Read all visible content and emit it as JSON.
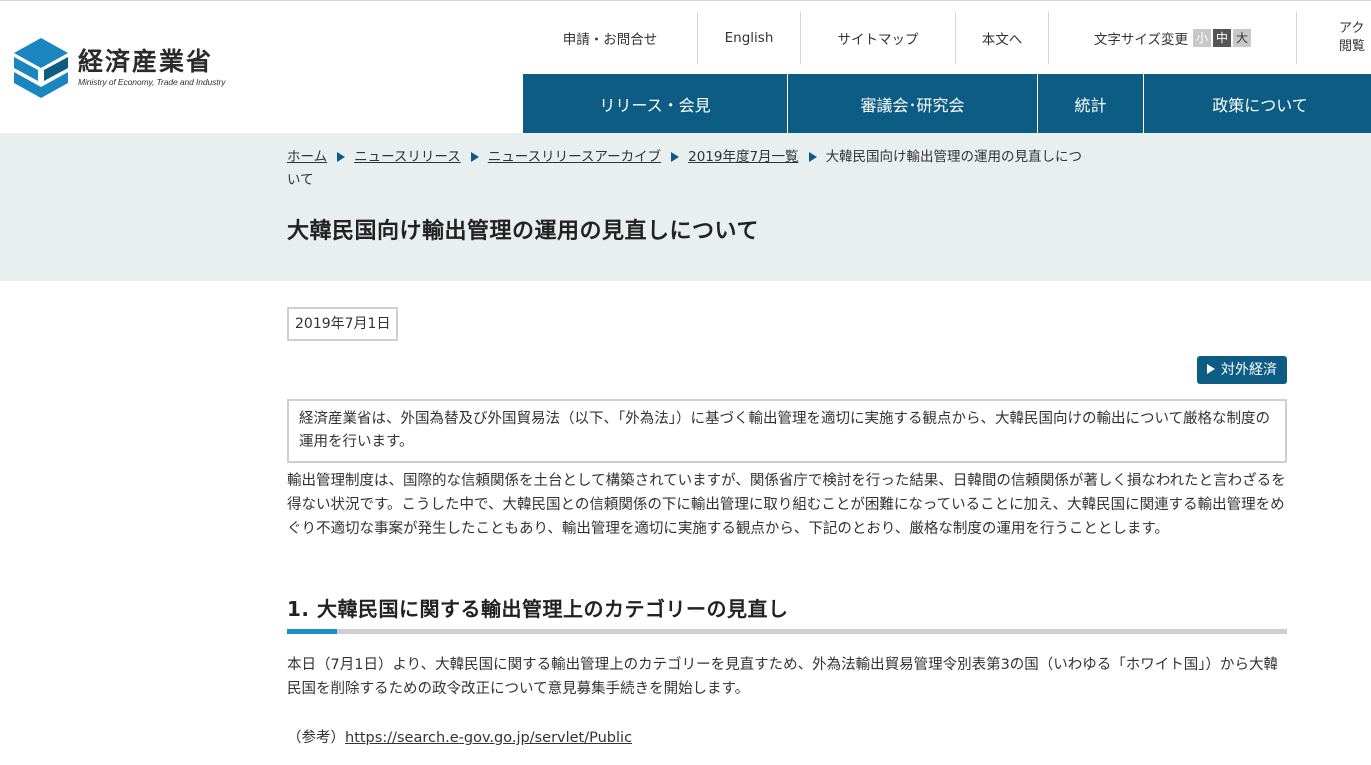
{
  "header": {
    "logo_jp": "経済産業省",
    "logo_en": "Ministry of Economy, Trade and Industry",
    "util_nav": {
      "contact": "申請・お問合せ",
      "english": "English",
      "sitemap": "サイトマップ",
      "skip": "本文へ",
      "font_size_label": "文字サイズ変更",
      "font_small": "小",
      "font_mid": "中",
      "font_large": "大",
      "access_line1": "アク",
      "access_line2": "閲覧"
    },
    "main_nav": [
      "リリース・会見",
      "審議会･研究会",
      "統計",
      "政策について"
    ]
  },
  "breadcrumb": {
    "items": [
      "ホーム",
      "ニュースリリース",
      "ニュースリリースアーカイブ",
      "2019年度7月一覧"
    ],
    "current": "大韓民国向け輸出管理の運用の見直しについて"
  },
  "page_title": "大韓民国向け輸出管理の運用の見直しについて",
  "content": {
    "date": "2019年7月1日",
    "tag": "対外経済",
    "lead": "経済産業省は、外国為替及び外国貿易法（以下、「外為法」）に基づく輸出管理を適切に実施する観点から、大韓民国向けの輸出について厳格な制度の運用を行います。",
    "body": "輸出管理制度は、国際的な信頼関係を土台として構築されていますが、関係省庁で検討を行った結果、日韓間の信頼関係が著しく損なわれたと言わざるを得ない状況です。こうした中で、大韓民国との信頼関係の下に輸出管理に取り組むことが困難になっていることに加え、大韓民国に関連する輸出管理をめぐり不適切な事案が発生したこともあり、輸出管理を適切に実施する観点から、下記のとおり、厳格な制度の運用を行うこととします。",
    "section1_title": "1.  大韓民国に関する輸出管理上のカテゴリーの見直し",
    "section1_body": "本日（7月1日）より、大韓民国に関する輸出管理上のカテゴリーを見直すため、外為法輸出貿易管理令別表第3の国（いわゆる「ホワイト国」）から大韓民国を削除するための政令改正について意見募集手続きを開始します。",
    "ref_label": "（参考）",
    "ref_link": "https://search.e-gov.go.jp/servlet/Public"
  },
  "colors": {
    "brand_blue": "#0d5c84",
    "accent_blue": "#1a8fc2",
    "band_bg": "#e8efee"
  }
}
